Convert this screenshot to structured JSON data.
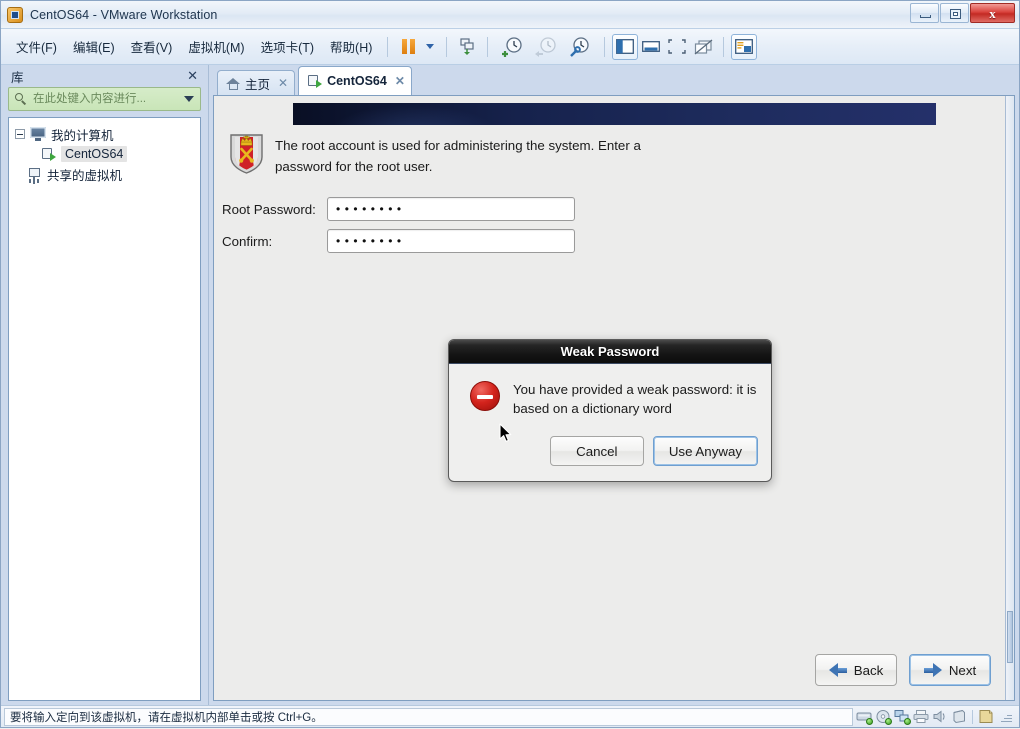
{
  "window": {
    "title": "CentOS64 - VMware Workstation",
    "app_icon": "vmware-icon",
    "controls": {
      "minimize": "minimize-button",
      "restore": "restore-button",
      "close": "close-button",
      "close_glyph": "x"
    }
  },
  "menu": {
    "items": [
      {
        "label": "文件(F)",
        "name": "menu-file"
      },
      {
        "label": "编辑(E)",
        "name": "menu-edit"
      },
      {
        "label": "查看(V)",
        "name": "menu-view"
      },
      {
        "label": "虚拟机(M)",
        "name": "menu-vm"
      },
      {
        "label": "选项卡(T)",
        "name": "menu-tabs"
      },
      {
        "label": "帮助(H)",
        "name": "menu-help"
      }
    ]
  },
  "toolbar": {
    "buttons": [
      {
        "name": "suspend-button",
        "icon": "pause-icon"
      },
      {
        "name": "power-dropdown-button",
        "icon": "chevron-down-icon"
      },
      {
        "name": "send-ctrl-alt-del-button",
        "icon": "vm-send-icon"
      },
      {
        "name": "take-snapshot-button",
        "icon": "snapshot-add-icon"
      },
      {
        "name": "revert-snapshot-button",
        "icon": "snapshot-revert-icon"
      },
      {
        "name": "snapshot-manager-button",
        "icon": "snapshot-manage-icon"
      },
      {
        "name": "show-library-button",
        "icon": "library-panel-icon"
      },
      {
        "name": "show-thumbnails-button",
        "icon": "thumbnail-bar-icon"
      },
      {
        "name": "fullscreen-button",
        "icon": "fullscreen-icon"
      },
      {
        "name": "unity-mode-button",
        "icon": "unity-icon"
      },
      {
        "name": "console-view-button",
        "icon": "console-view-icon"
      }
    ]
  },
  "sidebar": {
    "title": "库",
    "close_label": "✕",
    "search": {
      "placeholder": "在此处键入内容进行...",
      "value": "",
      "icon": "search-icon",
      "dropdown": "chevron-down-icon"
    },
    "tree": [
      {
        "label": "我的计算机",
        "name": "tree-my-computer",
        "icon": "monitor-icon",
        "selected": false
      },
      {
        "label": "CentOS64",
        "name": "tree-vm-centos64",
        "icon": "vm-icon",
        "selected": true
      },
      {
        "label": "共享的虚拟机",
        "name": "tree-shared-vms",
        "icon": "shared-vm-icon",
        "selected": false
      }
    ]
  },
  "tabs": [
    {
      "label": "主页",
      "name": "tab-home",
      "icon": "home-icon",
      "active": false,
      "close": "✕"
    },
    {
      "label": "CentOS64",
      "name": "tab-centos64",
      "icon": "vm-icon",
      "active": true,
      "close": "✕"
    }
  ],
  "installer": {
    "info_text": "The root account is used for administering the system.  Enter a password for the root user.",
    "shield_icon": "root-shield-icon",
    "fields": [
      {
        "label": "Root Password:",
        "name": "root-password-field",
        "value": "••••••••"
      },
      {
        "label": "Confirm:",
        "name": "confirm-password-field",
        "value": "••••••••"
      }
    ],
    "nav": {
      "back": {
        "label": "Back",
        "name": "back-button",
        "icon": "arrow-left-icon"
      },
      "next": {
        "label": "Next",
        "name": "next-button",
        "icon": "arrow-right-icon",
        "focused": true
      }
    }
  },
  "dialog": {
    "title": "Weak Password",
    "icon": "error-icon",
    "message": "You have provided a weak password: it is based on a dictionary word",
    "buttons": [
      {
        "label": "Cancel",
        "name": "cancel-button",
        "focused": false
      },
      {
        "label": "Use Anyway",
        "name": "use-anyway-button",
        "focused": true
      }
    ]
  },
  "status_bar": {
    "message": "要将输入定向到该虚拟机，请在虚拟机内部单击或按 Ctrl+G。",
    "icons": [
      {
        "name": "hard-disk-icon"
      },
      {
        "name": "cd-dvd-icon"
      },
      {
        "name": "network-adapter-icon"
      },
      {
        "name": "printer-icon"
      },
      {
        "name": "sound-card-icon"
      },
      {
        "name": "usb-device-icon"
      },
      {
        "name": "message-log-icon"
      }
    ]
  },
  "colors": {
    "accent": "#2a5d9e",
    "banner": "#16224c",
    "error": "#d3231c",
    "search_bg": "#cfe7bf"
  }
}
